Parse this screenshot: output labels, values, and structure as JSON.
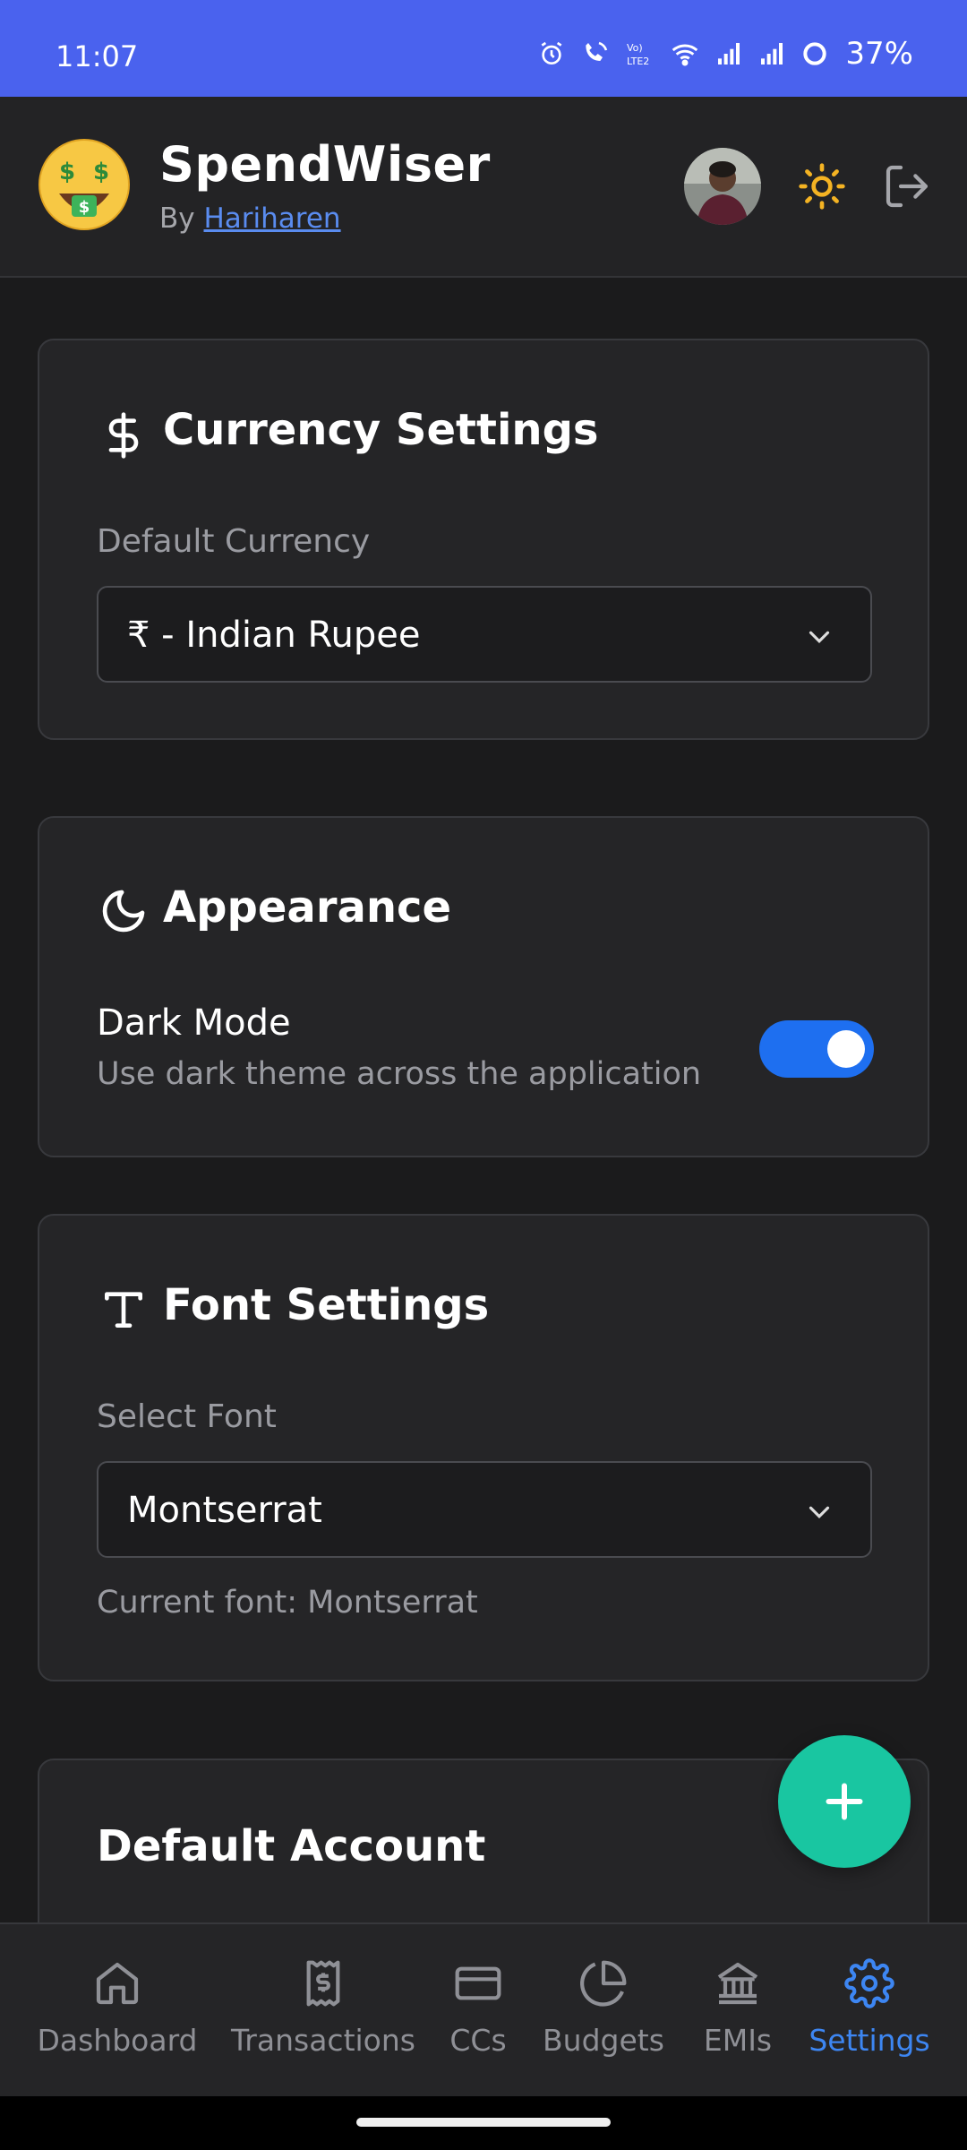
{
  "status_bar": {
    "time": "11:07",
    "battery": "37%",
    "icons": [
      "alarm-icon",
      "wifi-call-icon",
      "volte-icon",
      "wifi-icon",
      "signal-icon",
      "signal-icon",
      "battery-saver-icon"
    ]
  },
  "header": {
    "title": "SpendWiser",
    "by_prefix": "By",
    "author": "Hariharen",
    "logo_icon": "money-mouth-face-icon",
    "theme_icon": "sun-icon",
    "logout_icon": "logout-icon"
  },
  "currency_card": {
    "title": "Currency Settings",
    "icon": "dollar-icon",
    "label": "Default Currency",
    "selected": "₹ - Indian Rupee"
  },
  "appearance_card": {
    "title": "Appearance",
    "icon": "moon-icon",
    "toggle_label": "Dark Mode",
    "toggle_description": "Use dark theme across the application",
    "dark_mode_on": true
  },
  "font_card": {
    "title": "Font Settings",
    "icon": "type-icon",
    "label": "Select Font",
    "selected": "Montserrat",
    "helper": "Current font: Montserrat"
  },
  "account_card": {
    "title": "Default Account"
  },
  "fab": {
    "icon": "plus-icon"
  },
  "nav": {
    "items": [
      {
        "label": "Dashboard",
        "icon": "home-icon",
        "active": false
      },
      {
        "label": "Transactions",
        "icon": "receipt-icon",
        "active": false
      },
      {
        "label": "CCs",
        "icon": "credit-card-icon",
        "active": false
      },
      {
        "label": "Budgets",
        "icon": "pie-chart-icon",
        "active": false
      },
      {
        "label": "EMIs",
        "icon": "bank-icon",
        "active": false
      },
      {
        "label": "Settings",
        "icon": "gear-icon",
        "active": true
      }
    ]
  },
  "colors": {
    "status_bar": "#4a62ee",
    "accent_blue": "#1e6ff0",
    "fab": "#19c6a1",
    "active_nav": "#3d86f2"
  }
}
